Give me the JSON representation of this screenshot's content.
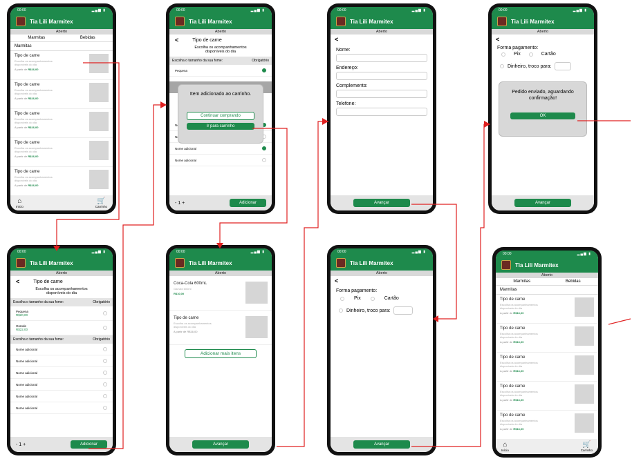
{
  "app": {
    "title": "Tia Lili Marmitex",
    "status_time": "00:00",
    "aberto": "Aberto",
    "tab_marmitas": "Marmitas",
    "tab_bebidas": "Bebidas",
    "section": "Marmitas",
    "nav_inicio": "Início",
    "nav_carrinho": "Carrinho"
  },
  "list_item": {
    "name": "Tipo de carne",
    "desc": "Escolha os acompanhamentos disponíveis do dia",
    "price_prefix": "A partir de ",
    "price": "R$16,00"
  },
  "detail": {
    "back": "<",
    "title": "Tipo de carne",
    "subtitle": "Escolha os acompanhamentos disponíveis do dia",
    "size_label": "Escolha o tamanho da sua fome:",
    "obrigatorio": "Obrigatório",
    "pequena": "Pequena",
    "pequena_price": "R$20,00",
    "grande": "Grande",
    "grande_price": "R$22,00",
    "extra": "Nome adicional",
    "qty": "- 1 +",
    "add_button": "Adicionar"
  },
  "modal_added": {
    "text": "Item adicionado ao carrinho.",
    "continue": "Continuar comprando",
    "go_cart": "Ir para carrinho"
  },
  "cart": {
    "item1_name": "Coca-Cola 600mL",
    "item1_desc": "Garrafa 600ml",
    "item1_price": "R$10,00",
    "item2_name": "Tipo de carne",
    "item2_desc": "Escolha os acompanhamentos disponíveis do dia",
    "item2_price": "A partir de R$16,00",
    "add_more": "Adicionar mais itens",
    "advance": "Avançar"
  },
  "form": {
    "nome": "Nome:",
    "endereco": "Endereço:",
    "complemento": "Complemento:",
    "telefone": "Telefone:",
    "advance": "Avançar"
  },
  "payment": {
    "label": "Forma pagamento:",
    "pix": "Pix",
    "cartao": "Cartão",
    "dinheiro": "Dinheiro, troco para:",
    "advance": "Avançar"
  },
  "modal_sent": {
    "text": "Pedido enviado, aguardando confirmação!",
    "ok": "OK"
  },
  "colors": {
    "brand": "#1e8a4c",
    "arrow": "#e02020"
  }
}
